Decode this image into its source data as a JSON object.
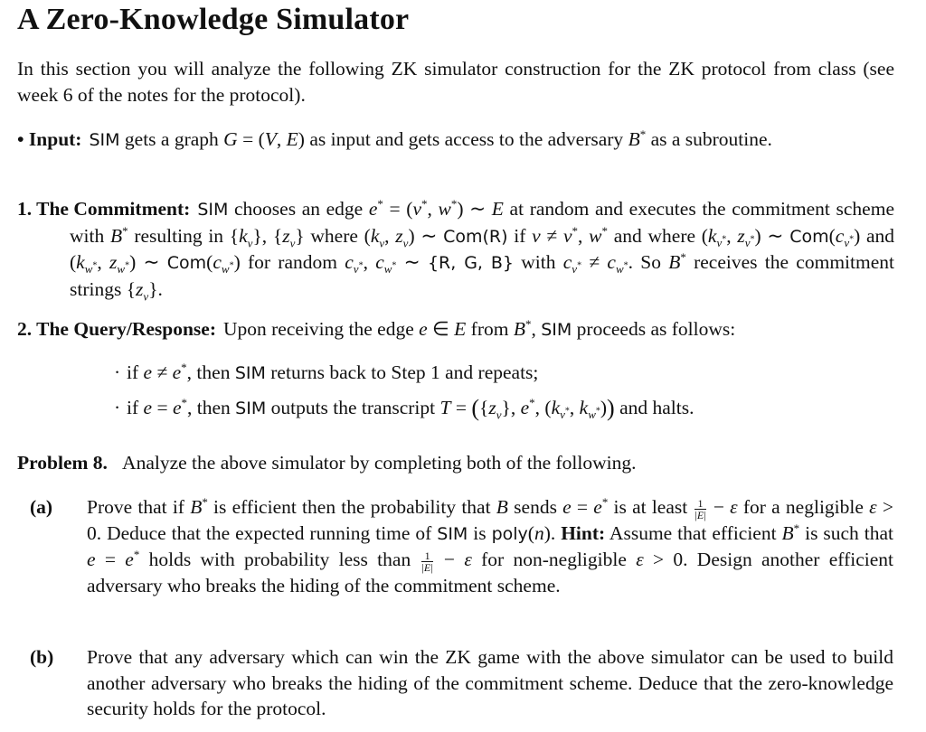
{
  "title": "A Zero-Knowledge Simulator",
  "intro": "In this section you will analyze the following ZK simulator construction for the ZK protocol from class (see week 6 of the notes for the protocol).",
  "input_item": {
    "bullet": "•",
    "label": "Input:",
    "html": "<span class=\"sf\">SIM</span> gets a graph <i>G</i> = (<i>V</i>, <i>E</i>) as input and gets access to the adversary <i>B</i><sup>*</sup> as a subroutine."
  },
  "steps": [
    {
      "number": "1.",
      "label": "The Commitment:",
      "html": "<span class=\"sf\">SIM</span> chooses an edge <i>e</i><sup>*</sup> = (<i>v</i><sup>*</sup>, <i>w</i><sup>*</sup>) ∼ <i>E</i> at random and executes the commitment scheme with <i>B</i><sup>*</sup> resulting in {<i>k<sub>v</sub></i>}, {<i>z<sub>v</sub></i>} where (<i>k<sub>v</sub></i>, <i>z<sub>v</sub></i>) ∼ <span class=\"sf\">Com(R)</span> if <i>v</i> ≠ <i>v</i><sup>*</sup>, <i>w</i><sup>*</sup> and where (<i>k</i><sub><i>v</i><sup>*</sup></sub>, <i>z</i><sub><i>v</i><sup>*</sup></sub>) ∼ <span class=\"sf\">Com</span>(<i>c</i><sub><i>v</i><sup>*</sup></sub>) and (<i>k</i><sub><i>w</i><sup>*</sup></sub>, <i>z</i><sub><i>w</i><sup>*</sup></sub>) ∼ <span class=\"sf\">Com</span>(<i>c</i><sub><i>w</i><sup>*</sup></sub>) for random <i>c</i><sub><i>v</i><sup>*</sup></sub>, <i>c</i><sub><i>w</i><sup>*</sup></sub> ∼ <span class=\"sf\">{R, G, B}</span> with <i>c</i><sub><i>v</i><sup>*</sup></sub> ≠ <i>c</i><sub><i>w</i><sup>*</sup></sub>. So <i>B</i><sup>*</sup> receives the commitment strings {<i>z<sub>v</sub></i>}."
    },
    {
      "number": "2.",
      "label": "The Query/Response:",
      "html": "Upon receiving the edge <i>e</i> ∈ <i>E</i> from <i>B</i><sup>*</sup>, <span class=\"sf\">SIM</span> proceeds as follows:",
      "subitems": [
        {
          "bullet": "·",
          "html": "if <i>e</i> ≠ <i>e</i><sup>*</sup>, then <span class=\"sf\">SIM</span> returns back to Step 1 and repeats;"
        },
        {
          "bullet": "·",
          "html": "if <i>e</i> = <i>e</i><sup>*</sup>, then <span class=\"sf\">SIM</span> outputs the transcript <i>T</i> = <span class=\"big\">(</span>{<i>z<sub>v</sub></i>}, <i>e</i><sup>*</sup>, (<i>k</i><sub><i>v</i><sup>*</sup></sub>, <i>k</i><sub><i>w</i><sup>*</sup></sub>)<span class=\"big\">)</span> and halts."
        }
      ]
    }
  ],
  "problem": {
    "label": "Problem 8.",
    "text": "Analyze the above simulator by completing both of the following.",
    "parts": [
      {
        "label": "(a)",
        "html": "Prove that if <i>B</i><sup>*</sup> is efficient then the probability that <i>B</i> sends <i>e</i> = <i>e</i><sup>*</sup> is at least <span class=\"frac\"><span class=\"num\">1</span><span class=\"den\">|<i>E</i>|</span></span> − <i>ε</i> for a negligible <i>ε</i> &gt; 0. Deduce that the expected running time of <span class=\"sf\">SIM</span> is <span class=\"sf\">poly</span>(<i>n</i>). <b>Hint:</b> Assume that efficient <i>B</i><sup>*</sup> is such that <i>e</i> = <i>e</i><sup>*</sup> holds with probability less than <span class=\"frac\"><span class=\"num\">1</span><span class=\"den\">|<i>E</i>|</span></span> − <i>ε</i> for non-negligible <i>ε</i> &gt; 0. Design another efficient adversary who breaks the hiding of the commitment scheme."
      },
      {
        "label": "(b)",
        "html": "Prove that any adversary which can win the ZK game with the above simulator can be used to build another adversary who breaks the hiding of the commitment scheme. Deduce that the zero-knowledge security holds for the protocol."
      }
    ]
  }
}
